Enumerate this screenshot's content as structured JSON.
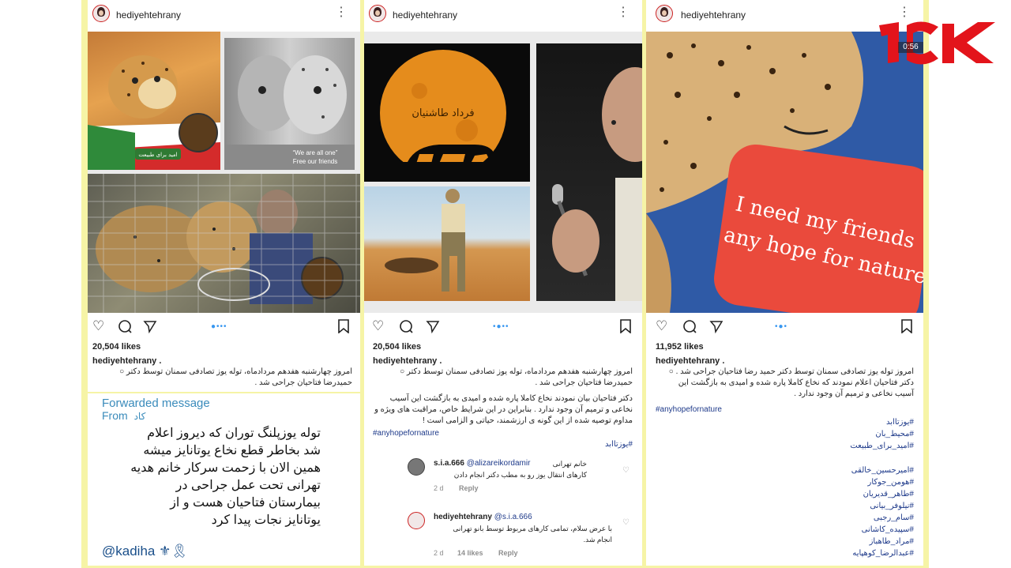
{
  "posts": [
    {
      "username": "hediyehtehrany",
      "likes": "20,504 likes",
      "caption_user": "hediyehtehrany .",
      "caption_lines": [
        "امروز چهارشنبه هفدهم مردادماه، توله یوز تصادفی سمنان توسط دکتر ○",
        "حمیدرضا فتاحیان جراحی شد ."
      ],
      "image_text": {
        "badge": "امید برای طبیعت",
        "quote": "“We are all one”",
        "quote2": "Free our friends"
      },
      "forwarded": {
        "title": "Forwarded message",
        "from_label": "From",
        "from_name": "کاد",
        "lines": [
          "توله یوزپلنگ توران که دیروز اعلام",
          "شد بخاطر قطع نخاع یوتانایز میشه",
          "همین الان با زحمت سرکار خانم هدیه",
          "تهرانی تحت عمل جراحی در",
          "بیمارستان فتاحیان هست و از",
          "یوتانایز نجات پیدا کرد"
        ],
        "mention": "@kadiha ⚜🎗"
      }
    },
    {
      "username": "hediyehtehrany",
      "likes": "20,504 likes",
      "caption_user": "hediyehtehrany .",
      "image_text": {
        "moon_title": "فرداد طاشنیان"
      },
      "caption_lines": [
        "امروز چهارشنبه هفدهم مردادماه، توله یوز تصادفی سمنان توسط دکتر ○",
        "حمیدرضا فتاحیان جراحی شد .",
        "دکتر فتاحیان بیان نمودند نخاع کاملا پاره شده و امیدی به بازگشت این آسیب",
        "نخاعی و ترمیم آن وجود ندارد . بنابراین در این شرایط خاص، مراقبت های ویژه و",
        "مداوم توصیه شده از این گونه ی ارزشمند، حیاتی و الزامی است !"
      ],
      "hashtag": "#anyhopefornature",
      "hashtag_fa": "#یوزتاابد",
      "comments": [
        {
          "user": "s.i.a.666",
          "mention": "@alizareikordamir",
          "lines": [
            "خانم تهرانی",
            "کارهای انتقال یوز رو به مطب دکتر انجام دادن"
          ],
          "age": "2 d",
          "likes": "",
          "reply": "Reply"
        },
        {
          "user": "hediyehtehrany",
          "mention": "@s.i.a.666",
          "lines": [
            "با عرض سلام، تمامی کارهای مربوط توسط بانو تهرانی",
            "انجام شد."
          ],
          "age": "2 d",
          "likes": "14 likes",
          "reply": "Reply"
        }
      ]
    },
    {
      "username": "hediyehtehrany",
      "likes": "11,952 likes",
      "caption_user": "hediyehtehrany .",
      "caption_lines": [
        "امروز توله یوز تصادفی سمنان توسط دکتر حمید رضا فتاحیان جراحی شد . ○",
        "دکتر فتاحیان اعلام نمودند که نخاع کاملا پاره شده و امیدی به بازگشت این",
        "آسیب نخاعی و ترمیم آن وجود ندارد ."
      ],
      "hashtag": "#anyhopefornature",
      "image_text": {
        "sign_line1": "I need my friends",
        "sign_line2": "any hope for nature"
      },
      "hashtags_fa": [
        "#یوزتاابد",
        "#محیط_بان",
        "#امید_برای_طبیعت",
        "",
        "#امیرحسین_خالقی",
        "#هومن_جوکار",
        "#طاهر_قدیریان",
        "#نیلوفر_بیانی",
        "#سام_رجبی",
        "#سپیده_کاشانی",
        "#مراد_طاهباز",
        "#عبدالرضا_کوهپایه"
      ]
    }
  ],
  "overlay": {
    "timer": "0:56"
  },
  "colors": {
    "frame": "#f6f4a6",
    "link": "#3897f0",
    "forward_blue": "#3a8bbb",
    "logo_red": "#e3141b"
  },
  "icons": [
    "heart-icon",
    "comment-icon",
    "share-icon",
    "bookmark-icon",
    "more-icon"
  ]
}
